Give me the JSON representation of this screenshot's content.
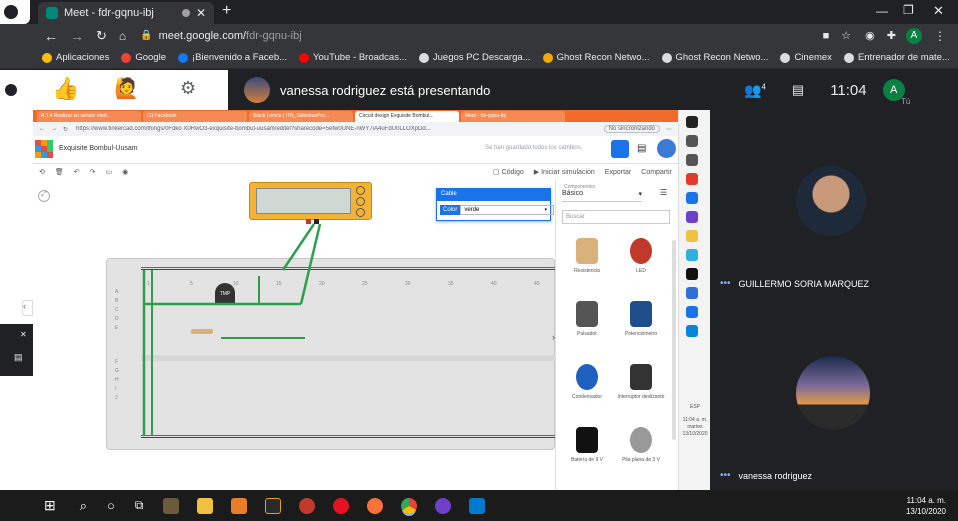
{
  "browser": {
    "tab_title": "Meet - fdr-gqnu-ibj",
    "url_domain": "meet.google.com/",
    "url_path": "fdr-gqnu-ibj",
    "profile_initial": "A"
  },
  "bookmarks": [
    {
      "label": "Aplicaciones",
      "icon": "apps-grid-icon",
      "color": "#fbbc04"
    },
    {
      "label": "Google",
      "icon": "google-icon",
      "color": "#ea4335"
    },
    {
      "label": "¡Bienvenido a Faceb...",
      "icon": "facebook-icon",
      "color": "#1877f2"
    },
    {
      "label": "YouTube - Broadcas...",
      "icon": "youtube-icon",
      "color": "#ff0000"
    },
    {
      "label": "Juegos PC Descarga...",
      "icon": "globe-icon",
      "color": "#dadce0"
    },
    {
      "label": "Ghost Recon Netwo...",
      "icon": "ghost-icon",
      "color": "#f2a900"
    },
    {
      "label": "Ghost Recon Netwo...",
      "icon": "globe-icon",
      "color": "#dadce0"
    },
    {
      "label": "Cinemex",
      "icon": "globe-icon",
      "color": "#dadce0"
    },
    {
      "label": "Entrenador de mate...",
      "icon": "globe-icon",
      "color": "#dadce0"
    }
  ],
  "meet": {
    "presenting_text": "vanessa rodriguez está presentando",
    "people_count": "4",
    "time": "11:04",
    "you_label": "Tú",
    "avatar_initial": "A",
    "participants": [
      {
        "name": "GUILLERMO SORIA MARQUEZ"
      },
      {
        "name": "vanessa rodriguez"
      }
    ]
  },
  "shared": {
    "tabs": [
      "A.T.4 Realizar un sensor med...",
      "(1) Facebook",
      "Slack | omce | ITN_SistemasPro...",
      "Circuit design Exquisite Bombul...",
      "Meet - fdr-gqnu-ibj"
    ],
    "url": "https://www.tinkercad.com/things/0Fdko X0RwO3-exquisite-bombul-uusam/editel?sharecode=5efw0UNE-nWY7iA4uFdU0LLOXpDd...",
    "incognito_label": "No sincronizando",
    "project_title": "Exquisite Bombul-Uusam",
    "save_status": "Se han guardado todos los cambios.",
    "code_label": "Código",
    "sim_label": "Iniciar simulación",
    "export_label": "Exportar",
    "share_label": "Compartir",
    "inspector": {
      "title": "Cable",
      "color_label": "Color",
      "color_value": "verde"
    },
    "components": {
      "header": "Componentes",
      "selected": "Básico",
      "search_placeholder": "Buscar",
      "items": [
        "Resistencia",
        "LED",
        "Pulsador",
        "Potenciómetro",
        "Condensador",
        "Interruptor deslizante",
        "Batería de 9 V",
        "Pila plana de 3 V"
      ]
    },
    "breadboard_rows": [
      "A",
      "B",
      "C",
      "D",
      "E",
      "F",
      "G",
      "H",
      "I",
      "J"
    ],
    "breadboard_cols": [
      "1",
      "5",
      "10",
      "15",
      "20",
      "25",
      "30",
      "35",
      "40",
      "45"
    ],
    "sensor_label": "TMP",
    "win_clock": {
      "time": "11:04 a. m.",
      "day": "martes",
      "date": "13/10/2020",
      "lang": "ESP"
    }
  },
  "taskbar": {
    "time": "11:04 a. m.",
    "date": "13/10/2020"
  },
  "colors": {
    "wire_green": "#2e9e4e",
    "inspector_blue": "#1a73e8",
    "meet_dark": "#202124",
    "avatar_green": "#0b8043"
  }
}
